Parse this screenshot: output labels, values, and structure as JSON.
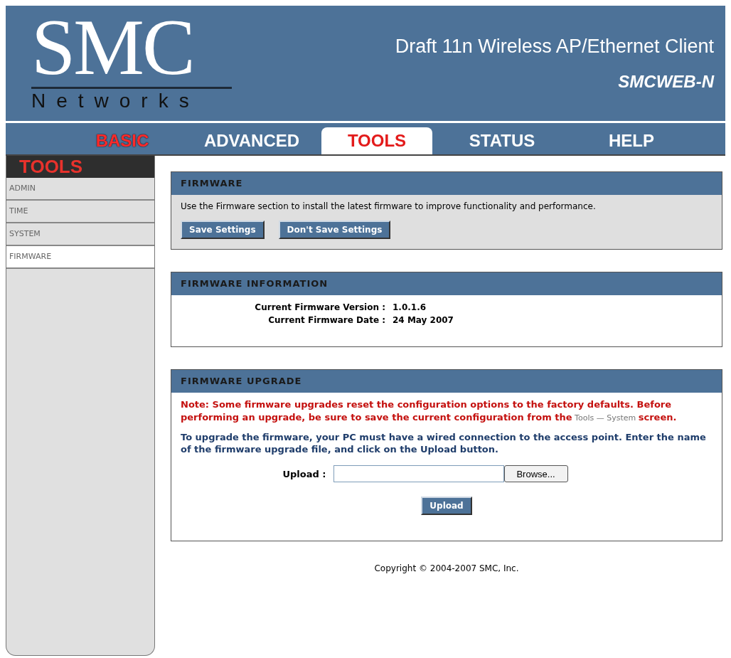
{
  "header": {
    "logo": "SMC",
    "logo_subtitle": "Networks",
    "product": "Draft 11n Wireless AP/Ethernet Client",
    "model": "SMCWEB-N"
  },
  "tabs": [
    {
      "label": "BASIC",
      "selected": false,
      "highlighted": true
    },
    {
      "label": "ADVANCED",
      "selected": false,
      "highlighted": false
    },
    {
      "label": "TOOLS",
      "selected": true,
      "highlighted": false
    },
    {
      "label": "STATUS",
      "selected": false,
      "highlighted": false
    },
    {
      "label": "HELP",
      "selected": false,
      "highlighted": false
    }
  ],
  "sidebar": {
    "title": "TOOLS",
    "items": [
      {
        "label": "ADMIN",
        "selected": false
      },
      {
        "label": "TIME",
        "selected": false
      },
      {
        "label": "SYSTEM",
        "selected": false
      },
      {
        "label": "FIRMWARE",
        "selected": true
      }
    ]
  },
  "sections": [
    {
      "kind": "intro",
      "title": "FIRMWARE",
      "text": "Use the Firmware section to install the latest firmware to improve functionality and performance.",
      "buttons": [
        "Save Settings",
        "Don't Save Settings"
      ]
    },
    {
      "kind": "info",
      "title": "FIRMWARE INFORMATION",
      "rows": [
        {
          "label": "Current Firmware Version :",
          "value": "1.0.1.6"
        },
        {
          "label": "Current Firmware Date :",
          "value": "24 May 2007"
        }
      ]
    },
    {
      "kind": "upgrade",
      "title": "FIRMWARE UPGRADE",
      "note": "**Note: Some firmware upgrades reset the configuration options to the factory defaults. Before performing an upgrade, be sure to save the current configuration from the** Tools — System **screen.**",
      "text": "To upgrade the firmware, your PC must have a wired connection to the access point. Enter the name of the firmware upgrade file, and click on the Upload button.",
      "field_label": "Upload :",
      "browse": "Browse...",
      "button": "Upload"
    }
  ],
  "footer": "Copyright © 2004-2007 SMC, Inc."
}
